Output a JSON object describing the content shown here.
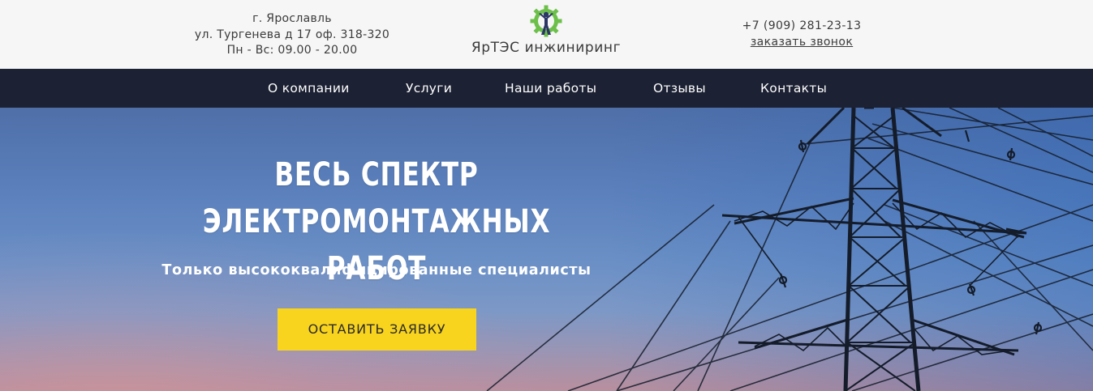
{
  "header": {
    "address_lines": [
      "г. Ярославль",
      "ул. Тургенева д 17 оф. 318-320",
      "Пн - Вс: 09.00 - 20.00"
    ],
    "brand_name": "ЯрТЭС инжиниринг",
    "logo_icon": "gear-person-logo-icon",
    "phone": "+7 (909) 281-23-13",
    "callback_label": "заказать звонок"
  },
  "nav": {
    "items": [
      "О компании",
      "Услуги",
      "Наши работы",
      "Отзывы",
      "Контакты"
    ]
  },
  "hero": {
    "title_line1": "ВЕСЬ СПЕКТР",
    "title_line2": "ЭЛЕКТРОМОНТАЖНЫХ РАБОТ",
    "subtitle": "Только высококвалифицированные специалисты",
    "cta_label": "ОСТАВИТЬ ЗАЯВКУ",
    "background_icon": "power-transmission-tower-icon"
  },
  "colors": {
    "nav_bg": "#1c2133",
    "cta_bg": "#f8d41e",
    "logo_green": "#6cc04a",
    "logo_navy": "#2b3566"
  }
}
